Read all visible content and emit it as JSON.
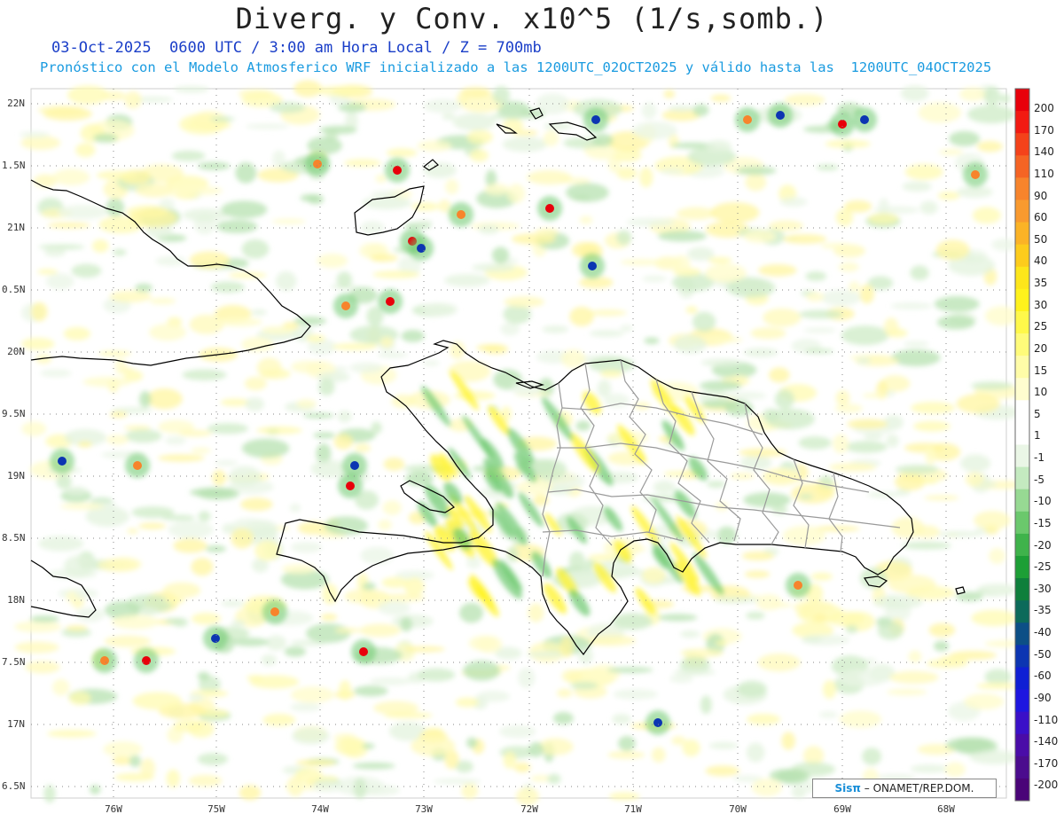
{
  "header": {
    "title": "Diverg. y Conv. x10^5 (1/s,somb.)",
    "subtitle_line1": "03-Oct-2025  0600 UTC / 3:00 am Hora Local / Z = 700mb",
    "subtitle_line2": "Pronóstico con el Modelo Atmosferico WRF inicializado a las 1200UTC_02OCT2025 y válido hasta las  1200UTC_04OCT2025"
  },
  "axes": {
    "lat_labels": [
      "22N",
      "1.5N",
      "21N",
      "0.5N",
      "20N",
      "9.5N",
      "19N",
      "8.5N",
      "18N",
      "7.5N",
      "17N",
      "6.5N"
    ],
    "lon_labels": [
      "76W",
      "75W",
      "74W",
      "73W",
      "72W",
      "71W",
      "70W",
      "69W",
      "68W"
    ]
  },
  "colorbar": {
    "labels": [
      "200",
      "170",
      "140",
      "110",
      "90",
      "60",
      "50",
      "40",
      "35",
      "30",
      "25",
      "20",
      "15",
      "10",
      "5",
      "1",
      "-1",
      "-5",
      "-10",
      "-15",
      "-20",
      "-25",
      "-30",
      "-35",
      "-40",
      "-50",
      "-60",
      "-90",
      "-110",
      "-140",
      "-170",
      "-200"
    ],
    "colors": [
      "#e8000b",
      "#f21a12",
      "#f4421a",
      "#f56424",
      "#f7842c",
      "#f99a2f",
      "#fbb326",
      "#fdcc1c",
      "#fde61b",
      "#fff21c",
      "#fff84a",
      "#fffb7a",
      "#fffca8",
      "#fffdcf",
      "#ffffff",
      "#ffffff",
      "#eaf6e6",
      "#c4eac0",
      "#97d993",
      "#6bc86c",
      "#3fb34b",
      "#1d9f36",
      "#0e7f3b",
      "#0c6a5a",
      "#0c4f86",
      "#0c35b2",
      "#0f1fd4",
      "#1e16e0",
      "#3a10c8",
      "#4a0ca8",
      "#4b0c8e",
      "#4a0478"
    ]
  },
  "credit": {
    "sis": "Sisπ",
    "org": "– ONAMET/REP.DOM."
  },
  "colors": {
    "coast": "#000000",
    "province_border": "#9a9a9a",
    "grid": "#888888"
  }
}
